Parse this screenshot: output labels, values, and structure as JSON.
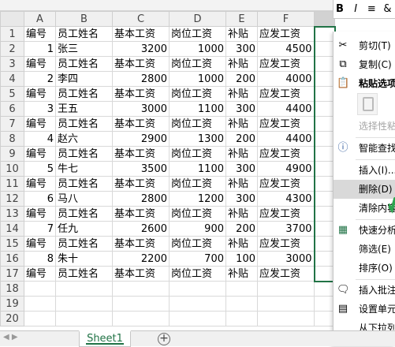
{
  "ribbon_mini": {
    "bold": "B",
    "italic": "I",
    "align": "≡",
    "more": "&"
  },
  "columns": [
    "A",
    "B",
    "C",
    "D",
    "E",
    "F"
  ],
  "row_numbers": [
    "1",
    "2",
    "3",
    "4",
    "5",
    "6",
    "7",
    "8",
    "9",
    "10",
    "11",
    "12",
    "13",
    "14",
    "15",
    "16",
    "17",
    "18",
    "19",
    "20"
  ],
  "header_row": [
    "编号",
    "员工姓名",
    "基本工资",
    "岗位工资",
    "补贴",
    "应发工资"
  ],
  "records": [
    [
      "1",
      "张三",
      "3200",
      "1000",
      "300",
      "4500"
    ],
    [
      "2",
      "李四",
      "2800",
      "1000",
      "200",
      "4000"
    ],
    [
      "3",
      "王五",
      "3000",
      "1100",
      "300",
      "4400"
    ],
    [
      "4",
      "赵六",
      "2900",
      "1300",
      "200",
      "4400"
    ],
    [
      "5",
      "牛七",
      "3500",
      "1100",
      "300",
      "4900"
    ],
    [
      "6",
      "马八",
      "2800",
      "1200",
      "300",
      "4300"
    ],
    [
      "7",
      "任九",
      "2600",
      "900",
      "200",
      "3700"
    ],
    [
      "8",
      "朱十",
      "2200",
      "700",
      "100",
      "3000"
    ]
  ],
  "context_menu": {
    "cut": "剪切(T)",
    "copy": "复制(C)",
    "paste_options": "粘贴选项",
    "paste_special": "选择性粘",
    "smart_lookup": "智能查找",
    "insert": "插入(I)...",
    "delete": "删除(D)",
    "clear": "清除内容",
    "quick_analysis": "快速分析",
    "filter": "筛选(E)",
    "sort": "排序(O)",
    "insert_comment": "插入批注",
    "format_cells": "设置单元",
    "dropdown": "从下拉列"
  },
  "sheet_tab": "Sheet1",
  "add_sheet": "+",
  "colors": {
    "accent": "#217346",
    "check": "#2ea44f"
  }
}
